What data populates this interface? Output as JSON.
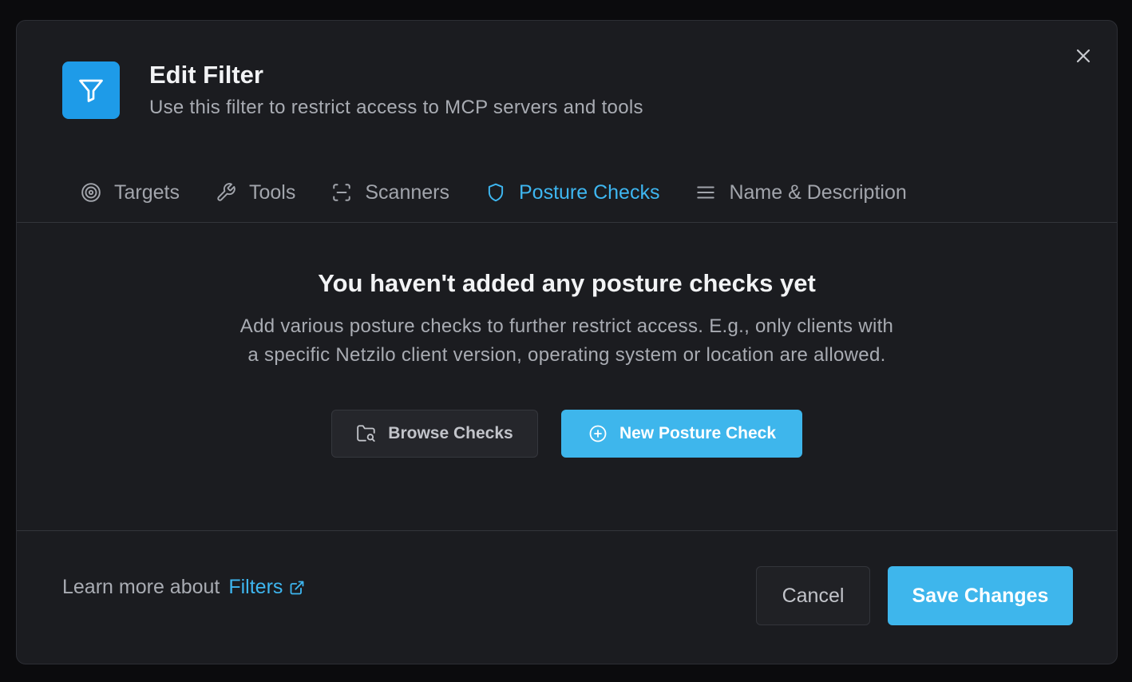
{
  "dialog": {
    "title": "Edit Filter",
    "subtitle": "Use this filter to restrict access to MCP servers and tools",
    "header_icon": "filter-icon",
    "close_icon": "close-icon"
  },
  "tabs": [
    {
      "label": "Targets",
      "icon": "target-icon",
      "active": false
    },
    {
      "label": "Tools",
      "icon": "wrench-icon",
      "active": false
    },
    {
      "label": "Scanners",
      "icon": "scan-icon",
      "active": false
    },
    {
      "label": "Posture Checks",
      "icon": "shield-icon",
      "active": true
    },
    {
      "label": "Name & Description",
      "icon": "menu-lines-icon",
      "active": false
    }
  ],
  "empty_state": {
    "title": "You haven't added any posture checks yet",
    "description": "Add various posture checks to further restrict access. E.g., only clients with a specific Netzilo client version, operating system or location are allowed.",
    "browse_label": "Browse Checks",
    "new_label": "New Posture Check"
  },
  "footer": {
    "learn_text": "Learn more about",
    "learn_link": "Filters",
    "cancel_label": "Cancel",
    "save_label": "Save Changes"
  },
  "colors": {
    "accent": "#3eb6ec",
    "modal_bg": "#1b1c20",
    "backdrop": "#0b0b0d"
  }
}
